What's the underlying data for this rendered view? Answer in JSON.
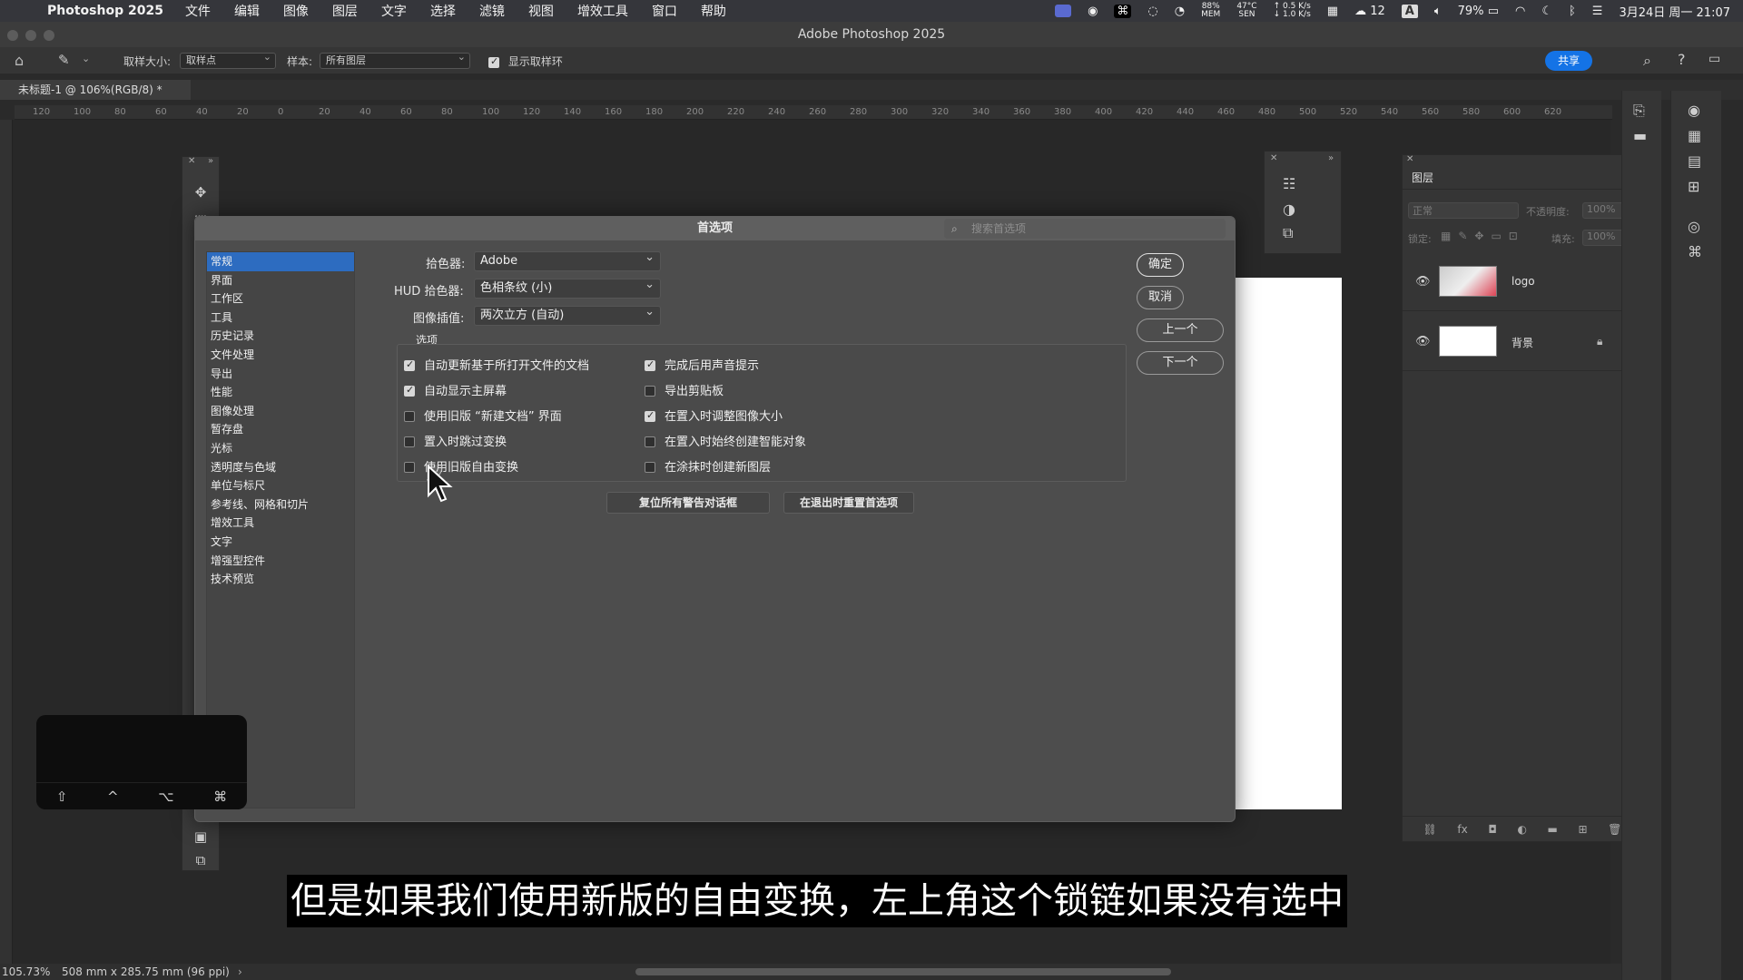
{
  "menubar": {
    "app": "Photoshop 2025",
    "items": [
      "文件",
      "编辑",
      "图像",
      "图层",
      "文字",
      "选择",
      "滤镜",
      "视图",
      "增效工具",
      "窗口",
      "帮助"
    ],
    "mem": "88%",
    "mem_label": "MEM",
    "temp": "47°C",
    "temp_label": "SEN",
    "net_up": "↑ 0.5 K/s",
    "net_down": "↓ 1.0 K/s",
    "wechat_count": "12",
    "input": "A",
    "battery": "79%",
    "datetime": "3月24日 周一  21:07"
  },
  "window": {
    "title": "Adobe Photoshop 2025"
  },
  "optbar": {
    "sample_size_label": "取样大小:",
    "sample_size_value": "取样点",
    "sample_label": "样本:",
    "sample_value": "所有图层",
    "show_ring_label": "显示取样环",
    "share": "共享"
  },
  "doc": {
    "tab": "未标题-1 @ 106%(RGB/8) *"
  },
  "ruler": [
    "120",
    "100",
    "80",
    "60",
    "40",
    "20",
    "0",
    "20",
    "40",
    "60",
    "80",
    "100",
    "120",
    "140",
    "160",
    "180",
    "200",
    "220",
    "240",
    "260",
    "280",
    "300",
    "320",
    "340",
    "360",
    "380",
    "400",
    "420",
    "440",
    "460",
    "480",
    "500",
    "520",
    "540",
    "560",
    "580",
    "600",
    "620"
  ],
  "layers": {
    "title": "图层",
    "blend": "正常",
    "opacity_label": "不透明度:",
    "opacity_value": "100%",
    "lock_label": "锁定:",
    "fill_label": "填充:",
    "fill_value": "100%",
    "rows": [
      {
        "name": "logo"
      },
      {
        "name": "背景"
      }
    ]
  },
  "dialog": {
    "title": "首选项",
    "search_placeholder": "搜索首选项",
    "nav": [
      "常规",
      "界面",
      "工作区",
      "工具",
      "历史记录",
      "文件处理",
      "导出",
      "性能",
      "图像处理",
      "暂存盘",
      "光标",
      "透明度与色域",
      "单位与标尺",
      "参考线、网格和切片",
      "增效工具",
      "文字",
      "增强型控件",
      "技术预览"
    ],
    "picker_label": "拾色器:",
    "picker_value": "Adobe",
    "hud_label": "HUD 拾色器:",
    "hud_value": "色相条纹 (小)",
    "interp_label": "图像插值:",
    "interp_value": "两次立方 (自动)",
    "options_label": "选项",
    "options": [
      {
        "label": "自动更新基于所打开文件的文档",
        "checked": true
      },
      {
        "label": "自动显示主屏幕",
        "checked": true
      },
      {
        "label": "使用旧版 “新建文档” 界面",
        "checked": false
      },
      {
        "label": "置入时跳过变换",
        "checked": false
      },
      {
        "label": "使用旧版自由变换",
        "checked": false
      },
      {
        "label": "完成后用声音提示",
        "checked": true
      },
      {
        "label": "导出剪贴板",
        "checked": false
      },
      {
        "label": "在置入时调整图像大小",
        "checked": true
      },
      {
        "label": "在置入时始终创建智能对象",
        "checked": false
      },
      {
        "label": "在涂抹时创建新图层",
        "checked": false
      }
    ],
    "reset_warnings": "复位所有警告对话框",
    "reset_on_quit": "在退出时重置首选项",
    "ok": "确定",
    "cancel": "取消",
    "prev": "上一个",
    "next": "下一个"
  },
  "keypad": {
    "keys": [
      "⇧",
      "^",
      "⌥",
      "⌘"
    ]
  },
  "subtitle": "但是如果我们使用新版的自由变换，左上角这个锁链如果没有选中",
  "status": {
    "zoom": "105.73%",
    "doc_info": "508 mm x 285.75 mm (96 ppi)"
  }
}
